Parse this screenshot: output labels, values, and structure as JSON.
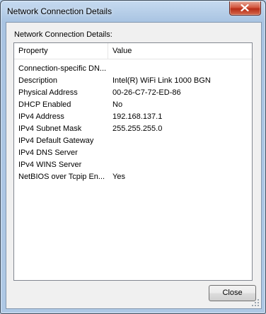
{
  "window": {
    "title": "Network Connection Details"
  },
  "group": {
    "label": "Network Connection Details:"
  },
  "table": {
    "columns": [
      "Property",
      "Value"
    ],
    "rows": [
      {
        "property": "Connection-specific DN...",
        "value": ""
      },
      {
        "property": "Description",
        "value": "Intel(R) WiFi Link 1000 BGN"
      },
      {
        "property": "Physical Address",
        "value": "00-26-C7-72-ED-86"
      },
      {
        "property": "DHCP Enabled",
        "value": "No"
      },
      {
        "property": "IPv4 Address",
        "value": "192.168.137.1"
      },
      {
        "property": "IPv4 Subnet Mask",
        "value": "255.255.255.0"
      },
      {
        "property": "IPv4 Default Gateway",
        "value": ""
      },
      {
        "property": "IPv4 DNS Server",
        "value": ""
      },
      {
        "property": "IPv4 WINS Server",
        "value": ""
      },
      {
        "property": "NetBIOS over Tcpip En...",
        "value": "Yes"
      }
    ]
  },
  "buttons": {
    "close_label": "Close"
  },
  "icons": {
    "close": "close-icon",
    "grip": "resize-grip-icon"
  },
  "colors": {
    "title_bar": "#a9c4e2",
    "close_button": "#c7402a",
    "client": "#f0f0f0"
  }
}
